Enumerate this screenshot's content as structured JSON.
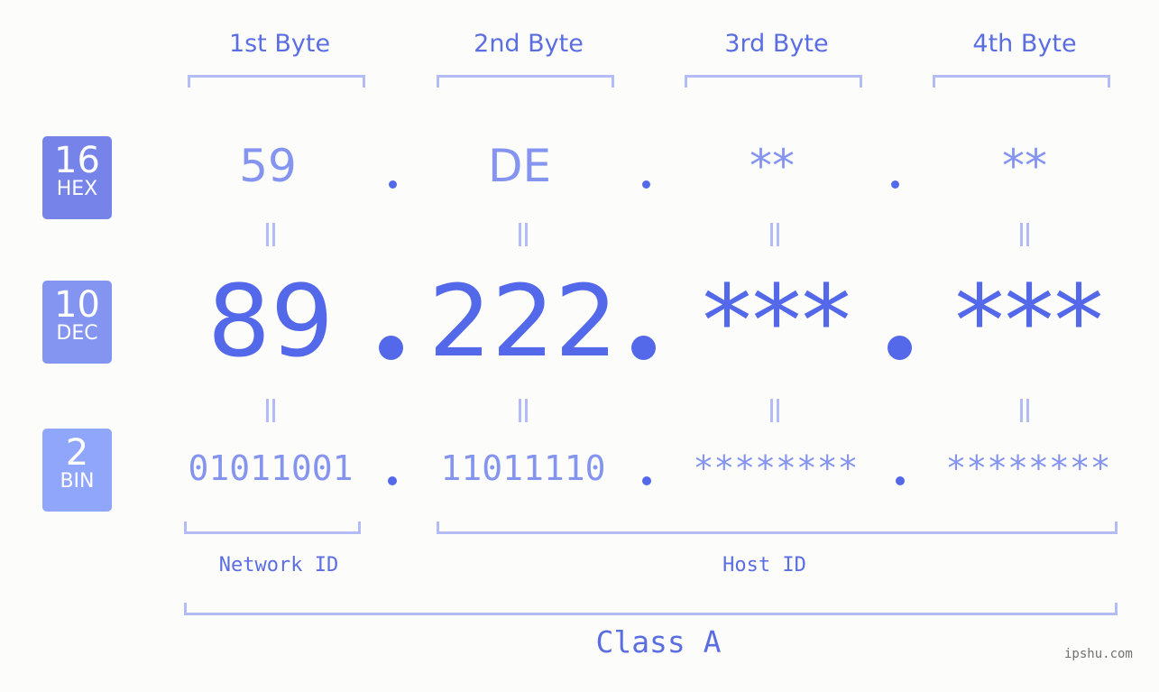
{
  "byte_headers": [
    "1st Byte",
    "2nd Byte",
    "3rd Byte",
    "4th Byte"
  ],
  "badges": {
    "hex": {
      "number": "16",
      "label": "HEX",
      "color": "#7684ea"
    },
    "dec": {
      "number": "10",
      "label": "DEC",
      "color": "#8494f1"
    },
    "bin": {
      "number": "2",
      "label": "BIN",
      "color": "#8fa6fa"
    }
  },
  "hex_values": [
    "59",
    "DE",
    "**",
    "**"
  ],
  "dec_values": [
    "89",
    "222",
    "***",
    "***"
  ],
  "bin_values": [
    "01011001",
    "11011110",
    "********",
    "********"
  ],
  "separator": ".",
  "segments": {
    "network_label": "Network ID",
    "host_label": "Host ID",
    "class_label": "Class A"
  },
  "watermark": "ipshu.com",
  "colors": {
    "accent": "#5468ea",
    "light_accent": "#8494ef",
    "bracket": "#b3bcf5"
  }
}
